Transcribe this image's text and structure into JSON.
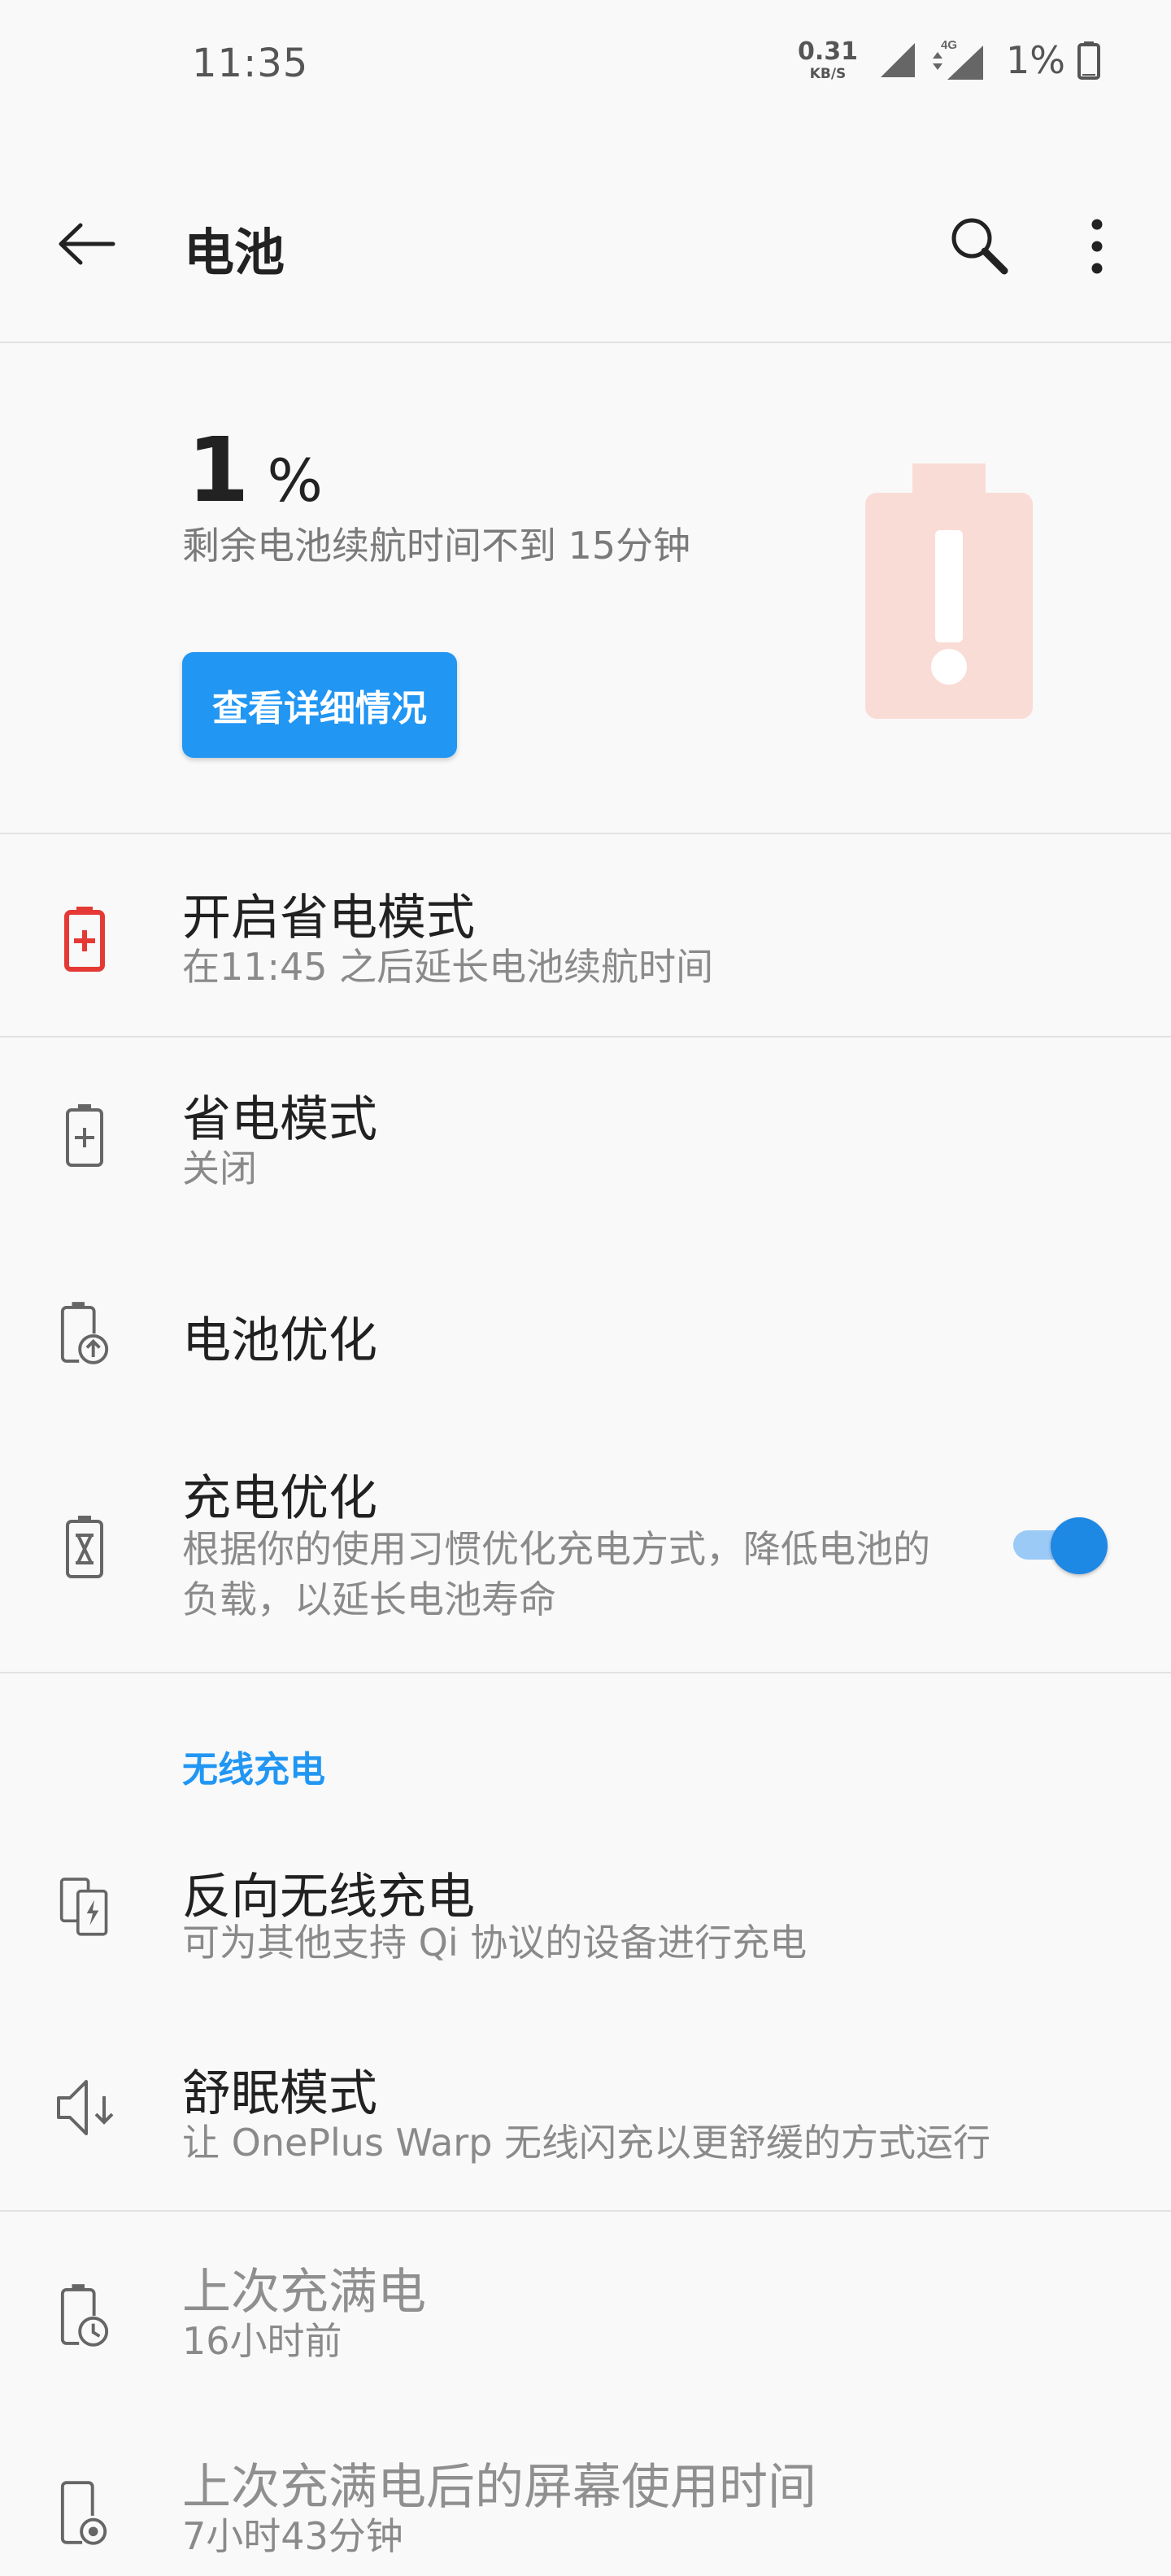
{
  "status_bar": {
    "time": "11:35",
    "net_speed_value": "0.31",
    "net_speed_unit": "KB/S",
    "network_type": "4G",
    "battery_percent": "1%"
  },
  "app_bar": {
    "title": "电池",
    "back_icon": "arrow-left-icon",
    "search_icon": "search-icon",
    "more_icon": "more-vert-icon"
  },
  "battery_header": {
    "level_value": "1",
    "level_unit": "%",
    "remaining_text": "剩余电池续航时间不到 15分钟",
    "details_button_label": "查看详细情况",
    "battery_icon": "battery-alert-icon",
    "alert_color": "#fadcd6"
  },
  "items": {
    "power_saving_suggestion": {
      "title": "开启省电模式",
      "subtitle": "在11:45 之后延长电池续航时间",
      "icon": "battery-plus-red-icon",
      "icon_color": "#e53935"
    },
    "power_saving_mode": {
      "title": "省电模式",
      "subtitle": "关闭",
      "icon": "battery-plus-icon"
    },
    "battery_optimization": {
      "title": "电池优化",
      "icon": "battery-upload-icon"
    },
    "charging_optimization": {
      "title": "充电优化",
      "subtitle": "根据你的使用习惯优化充电方式，降低电池的负载，以延长电池寿命",
      "icon": "battery-hourglass-icon",
      "toggle_on": true,
      "accent_color": "#1e88e5"
    }
  },
  "wireless_section": {
    "header": "无线充电",
    "reverse_wireless": {
      "title": "反向无线充电",
      "subtitle": "可为其他支持 Qi 协议的设备进行充电",
      "icon": "reverse-charge-icon"
    },
    "sleep_mode": {
      "title": "舒眠模式",
      "subtitle": "让 OnePlus Warp 无线闪充以更舒缓的方式运行",
      "icon": "volume-down-icon"
    }
  },
  "history": {
    "last_full_charge": {
      "title": "上次充满电",
      "subtitle": "16小时前",
      "icon": "battery-clock-icon"
    },
    "screen_usage": {
      "title": "上次充满电后的屏幕使用时间",
      "subtitle": "7小时43分钟",
      "icon": "phone-usage-icon"
    }
  }
}
